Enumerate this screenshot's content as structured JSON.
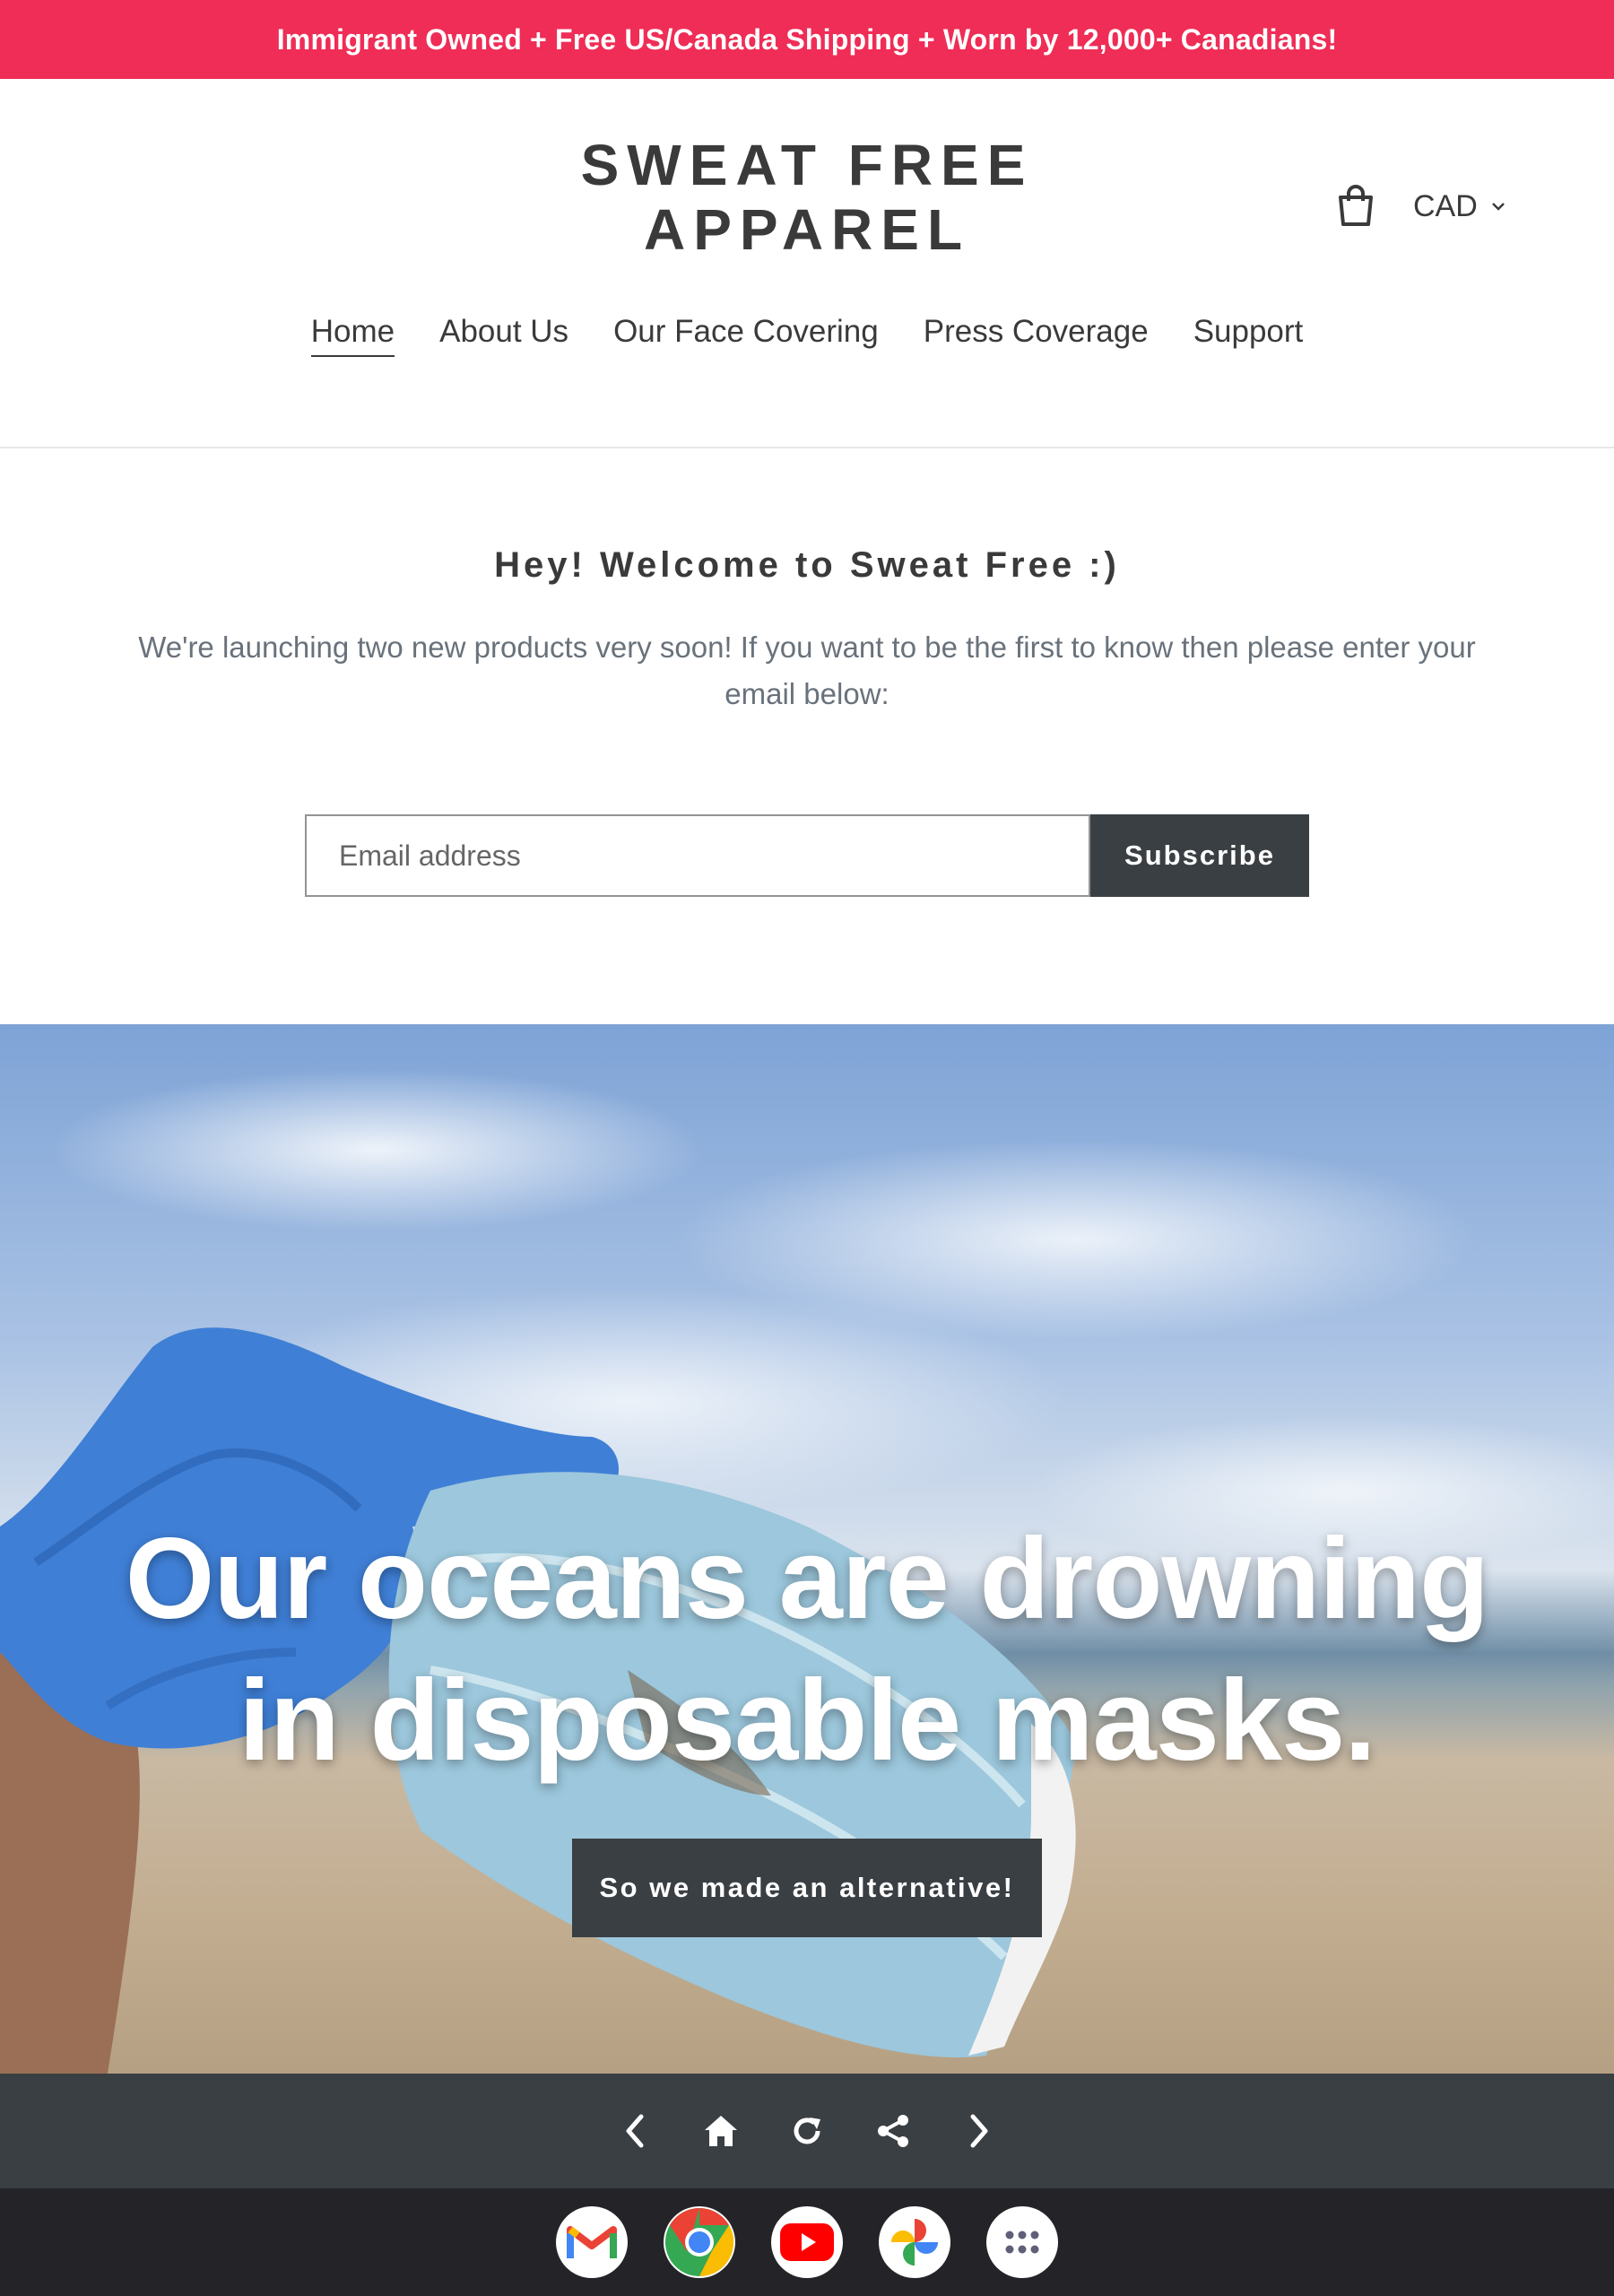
{
  "announcement": {
    "text": "Immigrant Owned + Free US/Canada Shipping + Worn by 12,000+ Canadians!",
    "bg_color": "#ef2d56"
  },
  "header": {
    "logo_line1": "SWEAT FREE",
    "logo_line2": "APPAREL",
    "cart_icon": "shopping-bag-icon",
    "currency": "CAD",
    "nav": [
      {
        "label": "Home",
        "active": true
      },
      {
        "label": "About Us"
      },
      {
        "label": "Our Face Covering"
      },
      {
        "label": "Press Coverage"
      },
      {
        "label": "Support"
      }
    ]
  },
  "welcome": {
    "heading": "Hey! Welcome to Sweat Free :)",
    "body": "We're launching two new products very soon! If you want to be the first to know then please enter your email below:",
    "email_placeholder": "Email address",
    "email_value": "",
    "subscribe_label": "Subscribe"
  },
  "hero": {
    "title_line1": "Our oceans are drowning",
    "title_line2": "in disposable masks.",
    "button_label": "So we made an alternative!"
  },
  "browser_bar": {
    "icons": [
      "back-icon",
      "home-icon",
      "reload-icon",
      "share-icon",
      "forward-icon"
    ]
  },
  "shelf": {
    "apps": [
      "gmail-icon",
      "chrome-icon",
      "youtube-icon",
      "photos-icon",
      "app-launcher-icon"
    ]
  },
  "colors": {
    "dark_button": "#3a3f43",
    "text": "#3a3a3a",
    "muted_text": "#69727b",
    "shelf": "#242428"
  }
}
